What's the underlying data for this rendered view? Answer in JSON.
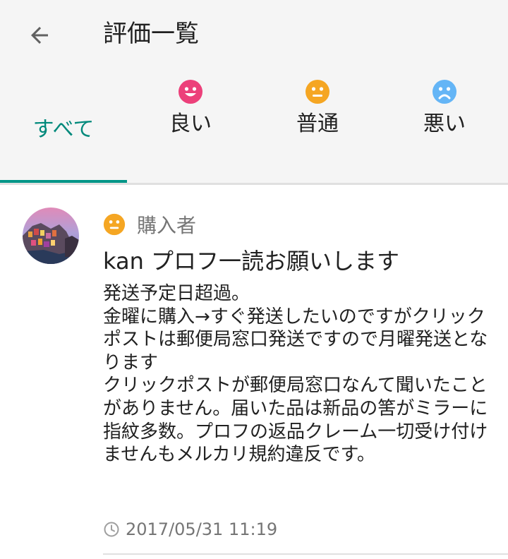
{
  "header": {
    "title": "評価一覧",
    "back_icon": "arrow-back-icon"
  },
  "tabs": [
    {
      "label": "すべて",
      "icon": null,
      "selected": true
    },
    {
      "label": "良い",
      "icon": "smile-face-icon",
      "color": "#ec407a"
    },
    {
      "label": "普通",
      "icon": "neutral-face-icon",
      "color": "#f5a623"
    },
    {
      "label": "悪い",
      "icon": "sad-face-icon",
      "color": "#64b5f6"
    }
  ],
  "colors": {
    "accent": "#009688",
    "neutral": "#f5a623",
    "good": "#ec407a",
    "bad": "#64b5f6"
  },
  "review": {
    "role": "購入者",
    "rating_icon": "neutral-face-icon",
    "user": "kan プロフ一読お願いします",
    "comment": "発送予定日超過。\n金曜に購入→すぐ発送したいのですがクリックポストは郵便局窓口発送ですので月曜発送となります\nクリックポストが郵便局窓口なんて聞いたことがありません。届いた品は新品の筈がミラーに指紋多数。プロフの返品クレーム一切受け付けませんもメルカリ規約違反です。",
    "date": "2017/05/31 11:19",
    "date_icon": "clock-icon"
  }
}
